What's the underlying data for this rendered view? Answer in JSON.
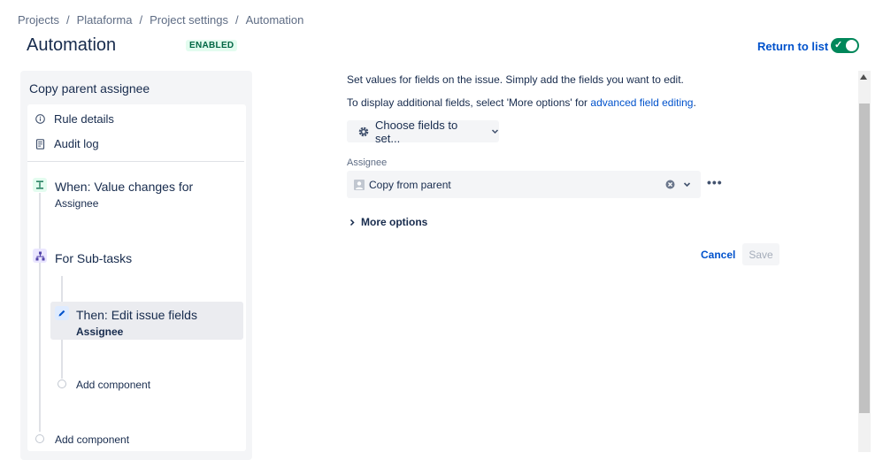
{
  "breadcrumb": {
    "items": [
      "Projects",
      "Plataforma",
      "Project settings",
      "Automation"
    ],
    "separator": "/"
  },
  "header": {
    "title": "Automation",
    "status_badge": "ENABLED",
    "return_link": "Return to list",
    "toggle_on": true
  },
  "sidebar": {
    "rule_name": "Copy parent assignee",
    "menu": [
      {
        "icon": "info-icon",
        "label": "Rule details"
      },
      {
        "icon": "document-icon",
        "label": "Audit log"
      }
    ],
    "trigger": {
      "icon": "value-change-icon",
      "title": "When: Value changes for",
      "subtitle": "Assignee"
    },
    "branch": {
      "icon": "branch-icon",
      "title": "For Sub-tasks"
    },
    "action": {
      "icon": "pencil-icon",
      "title": "Then: Edit issue fields",
      "subtitle": "Assignee"
    },
    "add_component_inner": "Add component",
    "add_component_outer": "Add component"
  },
  "editor": {
    "description_1": "Set values for fields on the issue. Simply add the fields you want to edit.",
    "description_2_prefix": "To display additional fields, select 'More options' for ",
    "description_2_link": "advanced field editing",
    "description_2_suffix": ".",
    "choose_fields_label": "Choose fields to set...",
    "assignee_label": "Assignee",
    "assignee_value": "Copy from parent",
    "more_options_label": "More options",
    "cancel_label": "Cancel",
    "save_label": "Save"
  },
  "colors": {
    "accent": "#0052cc",
    "toggle_on": "#00875a",
    "enabled_bg": "#e3fcef",
    "enabled_text": "#006644"
  }
}
